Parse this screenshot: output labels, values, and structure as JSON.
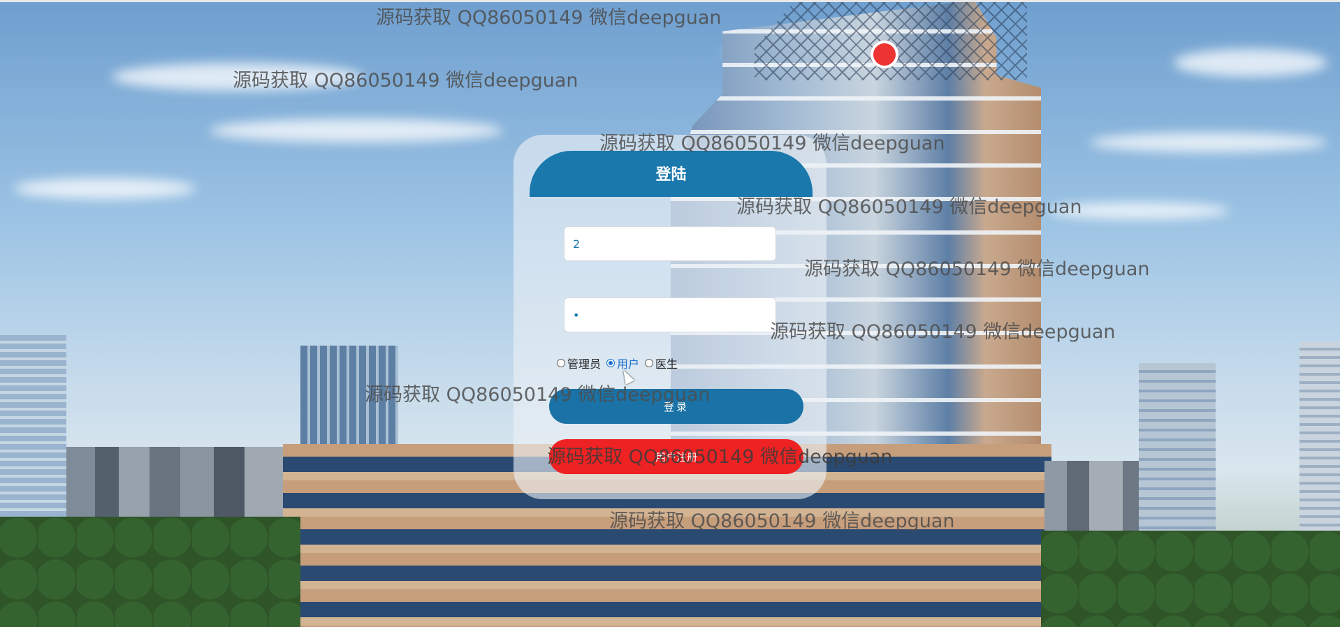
{
  "login": {
    "title": "登陆",
    "username_value": "2",
    "password_value": "•",
    "roles": [
      {
        "label": "管理员",
        "selected": false
      },
      {
        "label": "用户",
        "selected": true
      },
      {
        "label": "医生",
        "selected": false
      }
    ],
    "login_button": "登录",
    "register_button": "用户注册"
  },
  "watermarks": [
    "源码获取 QQ86050149 微信deepguan",
    "源码获取 QQ86050149 微信deepguan",
    "源码获取 QQ86050149 微信deepguan",
    "源码获取 QQ86050149 微信deepguan",
    "源码获取 QQ86050149 微信deepguan",
    "源码获取 QQ86050149 微信deepguan",
    "源码获取 QQ86050149 微信deepguan",
    "源码获取 QQ86050149 微信deepguan",
    "源码获取 QQ86050149 微信deepguan"
  ],
  "colors": {
    "panel_header": "#1a78ac",
    "login_button": "#1a72a6",
    "register_button": "#ee2222",
    "radio_selected": "#1a6fcf"
  }
}
